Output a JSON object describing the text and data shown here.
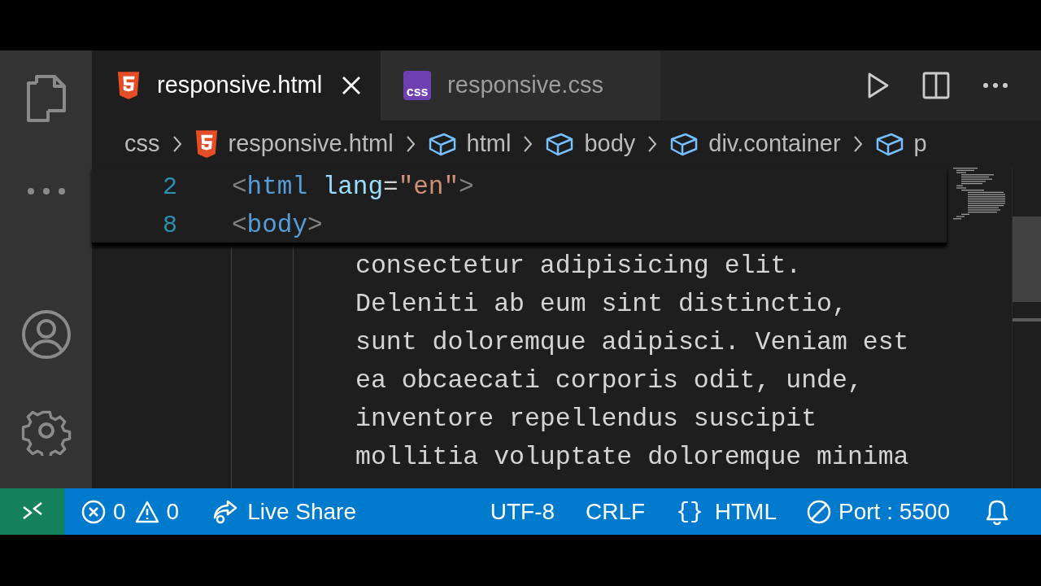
{
  "tabs": [
    {
      "label": "responsive.html",
      "kind": "html",
      "selected": true
    },
    {
      "label": "responsive.css",
      "kind": "css",
      "badge": "css",
      "selected": false
    }
  ],
  "breadcrumbs": [
    {
      "label": "css",
      "kind": "folder"
    },
    {
      "label": "responsive.html",
      "kind": "html"
    },
    {
      "label": "html",
      "kind": "symbol"
    },
    {
      "label": "body",
      "kind": "symbol"
    },
    {
      "label": "div.container",
      "kind": "symbol"
    },
    {
      "label": "p",
      "kind": "symbol"
    }
  ],
  "sticky_lines": [
    {
      "number": "2",
      "tokens": [
        {
          "text": "<",
          "kind": "punct"
        },
        {
          "text": "html",
          "kind": "tag"
        },
        {
          "text": "lang",
          "kind": "attr",
          "gap": true
        },
        {
          "text": "=",
          "kind": "plain"
        },
        {
          "text": "\"en\"",
          "kind": "string"
        },
        {
          "text": ">",
          "kind": "punct"
        }
      ]
    },
    {
      "number": "8",
      "tokens": [
        {
          "text": "<",
          "kind": "punct"
        },
        {
          "text": "body",
          "kind": "tag"
        },
        {
          "text": ">",
          "kind": "punct"
        }
      ]
    }
  ],
  "code_lines": [
    "consectetur adipisicing elit.",
    "Deleniti ab eum sint distinctio,",
    "sunt doloremque adipisci. Veniam est",
    "ea obcaecati corporis odit, unde,",
    "inventore repellendus suscipit",
    "mollitia voluptate doloremque minima"
  ],
  "status_bar": {
    "errors": "0",
    "warnings": "0",
    "live_share": "Live Share",
    "encoding": "UTF-8",
    "line_ending": "CRLF",
    "language_brace": "{}",
    "language": "HTML",
    "port": "Port : 5500"
  }
}
